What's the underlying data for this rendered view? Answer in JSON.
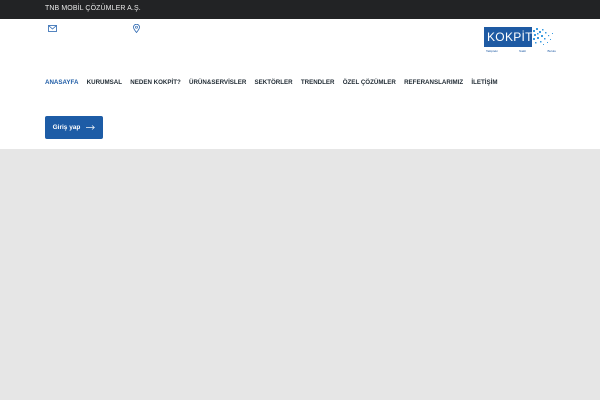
{
  "topbar": {
    "company_name": "TNB MOBİL ÇÖZÜMLER A.Ş."
  },
  "contact": {
    "mail_icon": "envelope-icon",
    "location_icon": "map-pin-icon"
  },
  "logo": {
    "wordmark": "KOKPİT",
    "tagline": [
      "Takipteki",
      "Nakit",
      "Bulutu"
    ],
    "brand_color": "#1e5aa3"
  },
  "nav": {
    "items": [
      "ANASAYFA",
      "KURUMSAL",
      "NEDEN KOKPİT?",
      "ÜRÜN&SERVİSLER",
      "SEKTÖRLER",
      "TRENDLER",
      "ÖZEL ÇÖZÜMLER",
      "REFERANSLARIMIZ",
      "İLETİŞİM"
    ],
    "active_color": "#1f5da6"
  },
  "login": {
    "label": "Giriş yap",
    "icon": "arrow-right-icon",
    "color": "#1d5ca6"
  }
}
